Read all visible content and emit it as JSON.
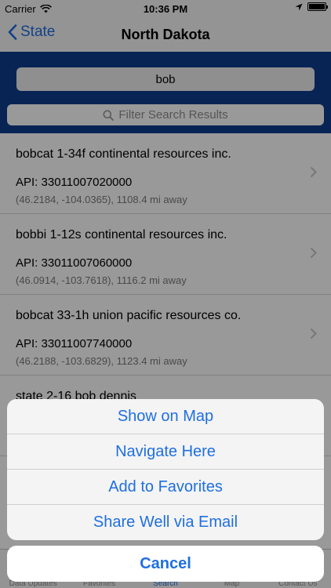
{
  "status_bar": {
    "carrier": "Carrier",
    "time": "10:36 PM",
    "battery_level": 1.0
  },
  "nav": {
    "back_label": "State",
    "title": "North Dakota"
  },
  "search": {
    "query": "bob",
    "filter_placeholder": "Filter Search Results"
  },
  "results": [
    {
      "name": "bobcat 1-34f continental resources inc.",
      "api": "API: 33011007020000",
      "location": "(46.2184, -104.0365), 1108.4 mi away"
    },
    {
      "name": "bobbi 1-12s continental resources inc.",
      "api": "API: 33011007060000",
      "location": "(46.0914, -103.7618), 1116.2 mi away"
    },
    {
      "name": "bobcat 33-1h union pacific resources co.",
      "api": "API: 33011007740000",
      "location": "(46.2188, -103.6829), 1123.4 mi away"
    },
    {
      "name": "state 2-16 bob dennis",
      "api": "",
      "location": ""
    }
  ],
  "tabs": [
    {
      "label": "Data Updates"
    },
    {
      "label": "Favorites"
    },
    {
      "label": "Search"
    },
    {
      "label": "Map"
    },
    {
      "label": "Contact Us"
    }
  ],
  "action_sheet": {
    "items": [
      "Show on Map",
      "Navigate Here",
      "Add to Favorites",
      "Share Well via Email"
    ],
    "cancel": "Cancel"
  },
  "colors": {
    "accent": "#1f6fe0",
    "search_header": "#0e3d8c"
  }
}
